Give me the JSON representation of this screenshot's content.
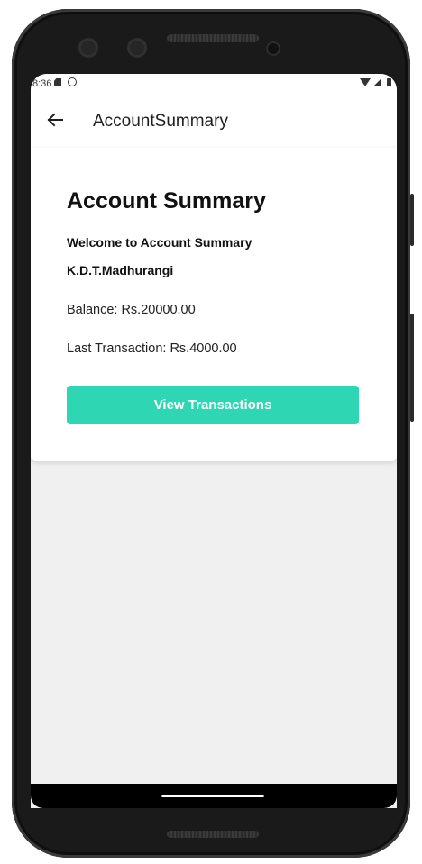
{
  "status_bar": {
    "time": "8:36",
    "icons": [
      "sd-card-icon",
      "sync-icon",
      "wifi-icon",
      "signal-icon",
      "battery-icon"
    ]
  },
  "app_bar": {
    "back_icon": "arrow-left-icon",
    "title": "AccountSummary"
  },
  "card": {
    "title": "Account Summary",
    "welcome": "Welcome to Account Summary",
    "user_name": "K.D.T.Madhurangi",
    "balance_label": "Balance: Rs.20000.00",
    "last_transaction_label": "Last Transaction: Rs.4000.00",
    "button_label": "View Transactions"
  },
  "colors": {
    "accent": "#2fd6b3",
    "screen_background": "#f0f0f0",
    "card_background": "#ffffff",
    "device_frame": "#1a1a1a"
  }
}
